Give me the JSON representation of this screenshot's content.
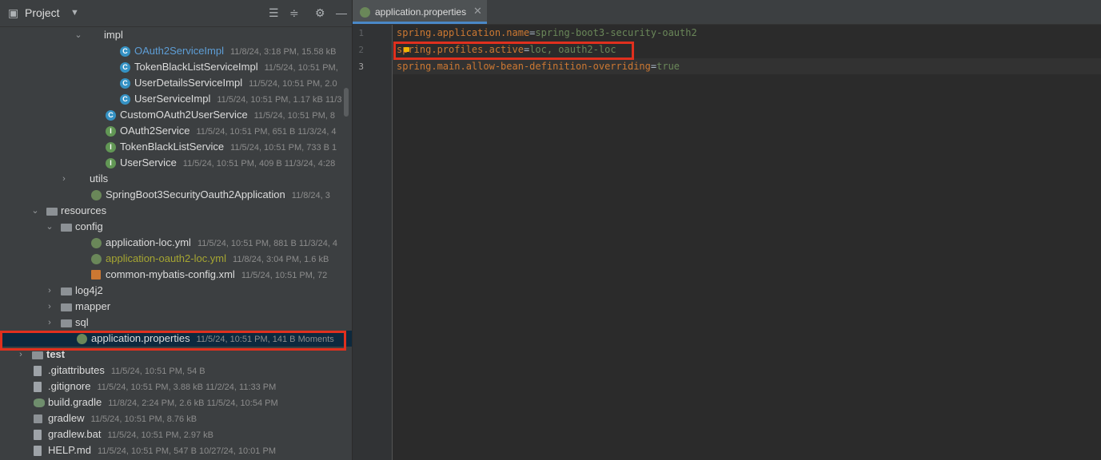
{
  "panel": {
    "title": "Project"
  },
  "tree": [
    {
      "name": "impl",
      "meta": "",
      "icon": "folder-icon",
      "kind": "package",
      "indent": 112,
      "expanded": true,
      "style": ""
    },
    {
      "name": "OAuth2ServiceImpl",
      "meta": "11/8/24, 3:18 PM, 15.58 kB",
      "icon": "class-icon",
      "kind": "class",
      "indent": 150,
      "expanded": null,
      "style": "blue"
    },
    {
      "name": "TokenBlackListServiceImpl",
      "meta": "11/5/24, 10:51 PM,",
      "icon": "class-icon",
      "kind": "class",
      "indent": 150,
      "expanded": null,
      "style": ""
    },
    {
      "name": "UserDetailsServiceImpl",
      "meta": "11/5/24, 10:51 PM, 2.0",
      "icon": "class-icon",
      "kind": "class",
      "indent": 150,
      "expanded": null,
      "style": ""
    },
    {
      "name": "UserServiceImpl",
      "meta": "11/5/24, 10:51 PM, 1.17 kB 11/3",
      "icon": "class-icon",
      "kind": "class",
      "indent": 150,
      "expanded": null,
      "style": ""
    },
    {
      "name": "CustomOAuth2UserService",
      "meta": "11/5/24, 10:51 PM, 8",
      "icon": "class-icon",
      "kind": "class",
      "indent": 132,
      "expanded": null,
      "style": ""
    },
    {
      "name": "OAuth2Service",
      "meta": "11/5/24, 10:51 PM, 651 B 11/3/24, 4",
      "icon": "interface-icon",
      "kind": "iface",
      "indent": 132,
      "expanded": null,
      "style": ""
    },
    {
      "name": "TokenBlackListService",
      "meta": "11/5/24, 10:51 PM, 733 B 1",
      "icon": "interface-icon",
      "kind": "iface",
      "indent": 132,
      "expanded": null,
      "style": ""
    },
    {
      "name": "UserService",
      "meta": "11/5/24, 10:51 PM, 409 B 11/3/24, 4:28",
      "icon": "interface-icon",
      "kind": "iface",
      "indent": 132,
      "expanded": null,
      "style": ""
    },
    {
      "name": "utils",
      "meta": "",
      "icon": "folder-icon",
      "kind": "package",
      "indent": 94,
      "expanded": false,
      "style": ""
    },
    {
      "name": "SpringBoot3SecurityOauth2Application",
      "meta": "11/8/24, 3",
      "icon": "spring-boot-icon",
      "kind": "spring",
      "indent": 114,
      "expanded": null,
      "style": ""
    },
    {
      "name": "resources",
      "meta": "",
      "icon": "resources-folder-icon",
      "kind": "resfolder",
      "indent": 58,
      "expanded": true,
      "style": ""
    },
    {
      "name": "config",
      "meta": "",
      "icon": "folder-icon",
      "kind": "folder",
      "indent": 76,
      "expanded": true,
      "style": ""
    },
    {
      "name": "application-loc.yml",
      "meta": "11/5/24, 10:51 PM, 881 B 11/3/24, 4",
      "icon": "spring-yaml-icon",
      "kind": "spring",
      "indent": 114,
      "expanded": null,
      "style": ""
    },
    {
      "name": "application-oauth2-loc.yml",
      "meta": "11/8/24, 3:04 PM, 1.6 kB",
      "icon": "spring-yaml-icon",
      "kind": "spring",
      "indent": 114,
      "expanded": null,
      "style": "olive"
    },
    {
      "name": "common-mybatis-config.xml",
      "meta": "11/5/24, 10:51 PM, 72",
      "icon": "xml-icon",
      "kind": "xml",
      "indent": 114,
      "expanded": null,
      "style": ""
    },
    {
      "name": "log4j2",
      "meta": "",
      "icon": "folder-icon",
      "kind": "folder",
      "indent": 76,
      "expanded": false,
      "style": ""
    },
    {
      "name": "mapper",
      "meta": "",
      "icon": "folder-icon",
      "kind": "folder",
      "indent": 76,
      "expanded": false,
      "style": ""
    },
    {
      "name": "sql",
      "meta": "",
      "icon": "folder-icon",
      "kind": "folder",
      "indent": 76,
      "expanded": false,
      "style": ""
    },
    {
      "name": "application.properties",
      "meta": "11/5/24, 10:51 PM, 141 B Moments",
      "icon": "spring-properties-icon",
      "kind": "spring",
      "indent": 96,
      "expanded": null,
      "style": "",
      "selected": true
    },
    {
      "name": "test",
      "meta": "",
      "icon": "folder-icon",
      "kind": "folder",
      "indent": 40,
      "expanded": false,
      "style": "bold"
    },
    {
      "name": ".gitattributes",
      "meta": "11/5/24, 10:51 PM, 54 B",
      "icon": "file-icon",
      "kind": "file",
      "indent": 42,
      "expanded": null,
      "style": ""
    },
    {
      "name": ".gitignore",
      "meta": "11/5/24, 10:51 PM, 3.88 kB 11/2/24, 11:33 PM",
      "icon": "file-icon",
      "kind": "file",
      "indent": 42,
      "expanded": null,
      "style": ""
    },
    {
      "name": "build.gradle",
      "meta": "11/8/24, 2:24 PM, 2.6 kB 11/5/24, 10:54 PM",
      "icon": "gradle-icon",
      "kind": "gradle",
      "indent": 42,
      "expanded": null,
      "style": ""
    },
    {
      "name": "gradlew",
      "meta": "11/5/24, 10:51 PM, 8.76 kB",
      "icon": "terminal-file-icon",
      "kind": "term",
      "indent": 42,
      "expanded": null,
      "style": ""
    },
    {
      "name": "gradlew.bat",
      "meta": "11/5/24, 10:51 PM, 2.97 kB",
      "icon": "file-icon",
      "kind": "file",
      "indent": 42,
      "expanded": null,
      "style": ""
    },
    {
      "name": "HELP.md",
      "meta": "11/5/24, 10:51 PM, 547 B 10/27/24, 10:01 PM",
      "icon": "markdown-icon",
      "kind": "file",
      "indent": 42,
      "expanded": null,
      "style": ""
    }
  ],
  "editor": {
    "tab_label": "application.properties",
    "lines": [
      {
        "num": "1",
        "key": "spring.application.name",
        "eq": "=",
        "value": "spring-boot3-security-oauth2"
      },
      {
        "num": "2",
        "key": "spring.profiles.active",
        "eq": "=",
        "value": "loc, oauth2-loc"
      },
      {
        "num": "3",
        "key": "spring.main.allow-bean-definition-overriding",
        "eq": "=",
        "value": "true"
      }
    ]
  },
  "colors": {
    "highlight": "#e0301e",
    "key": "#cc7832",
    "value": "#6a8759"
  }
}
